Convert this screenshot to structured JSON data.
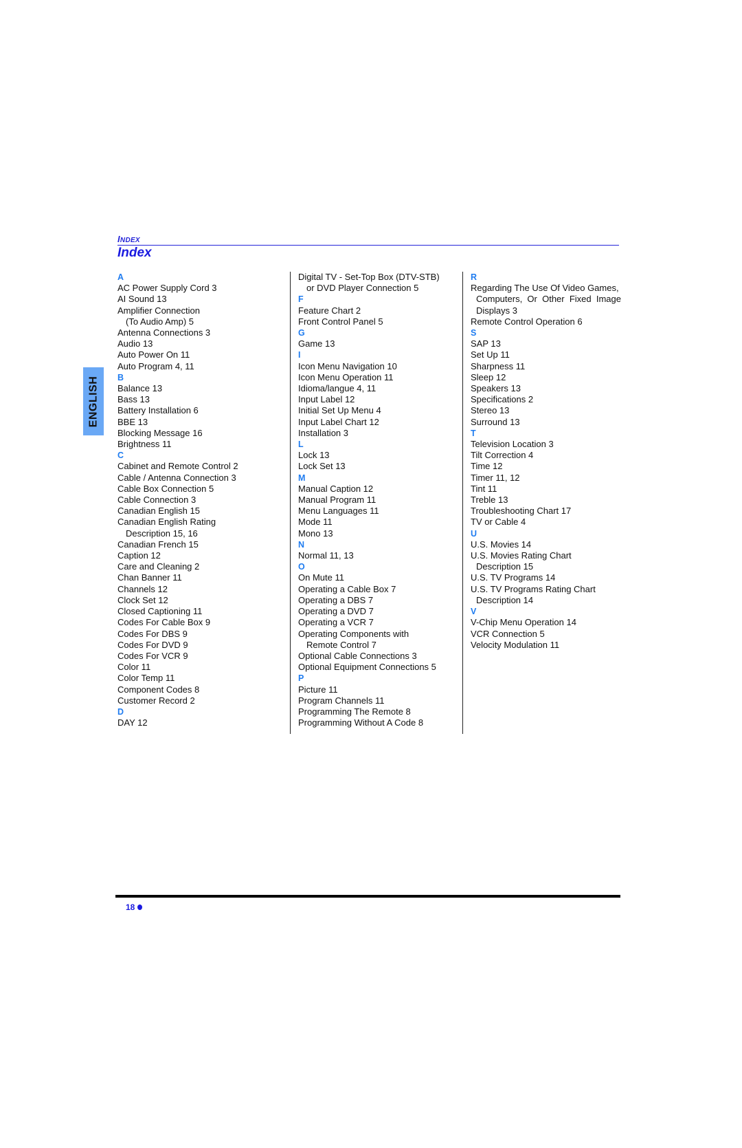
{
  "header": {
    "section_label_cap": "I",
    "section_label_rest": "NDEX",
    "title": "Index"
  },
  "language_tab": "ENGLISH",
  "columns": [
    {
      "groups": [
        {
          "letter": "A",
          "entries": [
            {
              "text": "AC Power Supply Cord 3"
            },
            {
              "text": "AI Sound 13"
            },
            {
              "text": "Amplifier Connection"
            },
            {
              "text": "(To Audio Amp) 5",
              "cont": true
            },
            {
              "text": "Antenna Connections 3"
            },
            {
              "text": "Audio 13"
            },
            {
              "text": "Auto Power On 11"
            },
            {
              "text": "Auto Program 4, 11"
            }
          ]
        },
        {
          "letter": "B",
          "entries": [
            {
              "text": "Balance 13"
            },
            {
              "text": "Bass 13"
            },
            {
              "text": "Battery Installation 6"
            },
            {
              "text": "BBE 13"
            },
            {
              "text": "Blocking Message 16"
            },
            {
              "text": "Brightness 11"
            }
          ]
        },
        {
          "letter": "C",
          "entries": [
            {
              "text": "Cabinet and Remote Control 2"
            },
            {
              "text": "Cable / Antenna Connection 3"
            },
            {
              "text": "Cable Box Connection 5"
            },
            {
              "text": "Cable Connection 3"
            },
            {
              "text": "Canadian English 15"
            },
            {
              "text": "Canadian English Rating"
            },
            {
              "text": "Description 15, 16",
              "cont": true
            },
            {
              "text": "Canadian French 15"
            },
            {
              "text": "Caption 12"
            },
            {
              "text": "Care and Cleaning 2"
            },
            {
              "text": "Chan Banner 11"
            },
            {
              "text": "Channels 12"
            },
            {
              "text": "Clock Set 12"
            },
            {
              "text": "Closed Captioning 11"
            },
            {
              "text": "Codes For Cable Box 9"
            },
            {
              "text": "Codes For DBS 9"
            },
            {
              "text": "Codes For DVD 9"
            },
            {
              "text": "Codes For VCR 9"
            },
            {
              "text": "Color 11"
            },
            {
              "text": "Color Temp 11"
            },
            {
              "text": "Component Codes 8"
            },
            {
              "text": "Customer Record 2"
            }
          ]
        },
        {
          "letter": "D",
          "entries": [
            {
              "text": "DAY  12"
            }
          ]
        }
      ]
    },
    {
      "groups": [
        {
          "letter": "",
          "entries": [
            {
              "text": "Digital TV - Set-Top Box (DTV-STB)"
            },
            {
              "text": "or DVD Player Connection 5",
              "cont": true
            }
          ]
        },
        {
          "letter": "F",
          "entries": [
            {
              "text": "Feature Chart 2"
            },
            {
              "text": "Front Control Panel 5"
            }
          ]
        },
        {
          "letter": "G",
          "entries": [
            {
              "text": "Game 13"
            }
          ]
        },
        {
          "letter": "I",
          "entries": [
            {
              "text": "Icon Menu Navigation 10"
            },
            {
              "text": "Icon Menu Operation 11"
            },
            {
              "text": "Idioma/langue 4, 11"
            },
            {
              "text": "Input Label 12"
            },
            {
              "text": "Initial Set Up Menu 4"
            },
            {
              "text": "Input Label Chart 12"
            },
            {
              "text": "Installation 3"
            }
          ]
        },
        {
          "letter": "L",
          "entries": [
            {
              "text": "Lock 13"
            },
            {
              "text": "Lock Set 13"
            }
          ]
        },
        {
          "letter": "M",
          "entries": [
            {
              "text": "Manual Caption 12"
            },
            {
              "text": "Manual Program 11"
            },
            {
              "text": "Menu Languages 11"
            },
            {
              "text": "Mode 11"
            },
            {
              "text": "Mono 13"
            }
          ]
        },
        {
          "letter": "N",
          "entries": [
            {
              "text": "Normal 11, 13"
            }
          ]
        },
        {
          "letter": "O",
          "entries": [
            {
              "text": "On Mute 11"
            },
            {
              "text": "Operating a Cable Box 7"
            },
            {
              "text": "Operating a DBS 7"
            },
            {
              "text": "Operating a DVD 7"
            },
            {
              "text": "Operating a VCR 7"
            },
            {
              "text": "Operating Components with"
            },
            {
              "text": "Remote Control 7",
              "cont": true
            },
            {
              "text": "Optional Cable Connections 3"
            },
            {
              "text": "Optional Equipment Connections 5"
            }
          ]
        },
        {
          "letter": "P",
          "entries": [
            {
              "text": "Picture 11"
            },
            {
              "text": "Program Channels 11"
            },
            {
              "text": "Programming The Remote 8"
            },
            {
              "text": "Programming Without A Code 8"
            }
          ]
        }
      ]
    },
    {
      "groups": [
        {
          "letter": "R",
          "entries": [
            {
              "text": "Regarding The Use Of Video Games,"
            },
            {
              "text": "Computers, Or Other Fixed Image",
              "justify": true
            },
            {
              "text": "Displays 3",
              "cont3": true
            },
            {
              "text": "Remote Control Operation 6"
            }
          ]
        },
        {
          "letter": "S",
          "entries": [
            {
              "text": "SAP 13"
            },
            {
              "text": "Set Up 11"
            },
            {
              "text": "Sharpness 11"
            },
            {
              "text": "Sleep 12"
            },
            {
              "text": "Speakers 13"
            },
            {
              "text": "Specifications 2"
            },
            {
              "text": "Stereo 13"
            },
            {
              "text": "Surround 13"
            }
          ]
        },
        {
          "letter": "T",
          "entries": [
            {
              "text": "Television Location 3"
            },
            {
              "text": "Tilt Correction 4"
            },
            {
              "text": "Time 12"
            },
            {
              "text": "Timer 11, 12"
            },
            {
              "text": "Tint 11"
            },
            {
              "text": "Treble 13"
            },
            {
              "text": "Troubleshooting Chart 17"
            },
            {
              "text": "TV or Cable 4"
            }
          ]
        },
        {
          "letter": "U",
          "entries": [
            {
              "text": "U.S. Movies 14"
            },
            {
              "text": "U.S. Movies Rating Chart"
            },
            {
              "text": "Description 15",
              "cont3": true
            },
            {
              "text": "U.S. TV Programs 14"
            },
            {
              "text": "U.S. TV Programs Rating Chart"
            },
            {
              "text": "Description 14",
              "cont3": true
            }
          ]
        },
        {
          "letter": "V",
          "entries": [
            {
              "text": "V-Chip Menu Operation 14"
            },
            {
              "text": "VCR Connection 5"
            },
            {
              "text": "Velocity Modulation 11"
            }
          ]
        }
      ]
    }
  ],
  "footer": {
    "page_number": "18"
  }
}
